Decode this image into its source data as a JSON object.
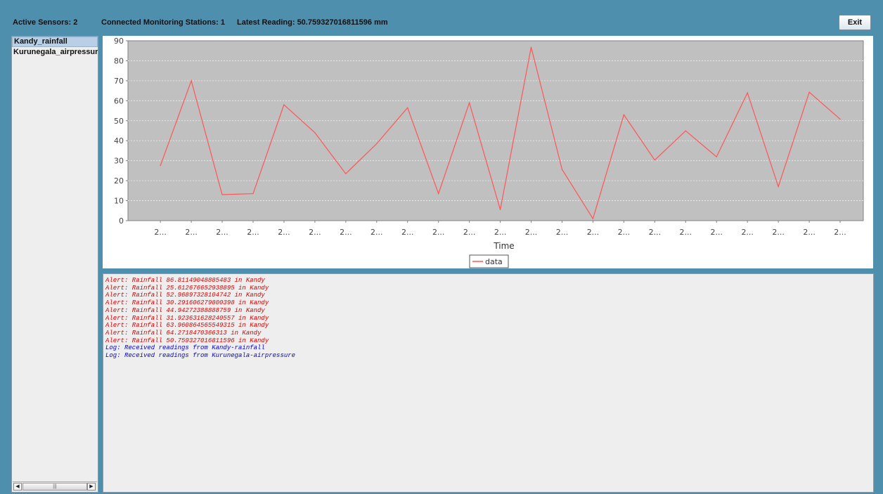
{
  "header": {
    "active_sensors": "Active Sensors:  2",
    "stations": "Connected Monitoring Stations:  1",
    "latest": "Latest Reading:  50.759327016811596 mm",
    "exit_label": "Exit"
  },
  "sidebar": {
    "items": [
      {
        "label": "Kandy_rainfall",
        "selected": true
      },
      {
        "label": "Kurunegala_airpressure",
        "selected": false
      }
    ],
    "scroll_left_glyph": "◀",
    "scroll_right_glyph": "▶",
    "scroll_thumb_glyph": "|||"
  },
  "chart_data": {
    "type": "line",
    "xlabel": "Time",
    "ylabel": "",
    "ylim": [
      0,
      90
    ],
    "yticks": [
      0,
      10,
      20,
      30,
      40,
      50,
      60,
      70,
      80,
      90
    ],
    "grid": true,
    "legend": "bottom-center",
    "categories": [
      "2...",
      "2...",
      "2...",
      "2...",
      "2...",
      "2...",
      "2...",
      "2...",
      "2...",
      "2...",
      "2...",
      "2...",
      "2...",
      "2...",
      "2...",
      "2...",
      "2...",
      "2...",
      "2...",
      "2...",
      "2...",
      "2...",
      "2..."
    ],
    "series": [
      {
        "name": "data",
        "color": "#ff5555",
        "values": [
          27.5,
          70.0,
          13.0,
          13.5,
          58.0,
          44.0,
          23.5,
          38.5,
          56.5,
          13.5,
          59.0,
          5.5,
          86.81149048885483,
          25.612676652938895,
          1.0,
          52.96897328104742,
          30.291606279800398,
          44.94272388888759,
          31.923631628240557,
          63.960864565549315,
          17.0,
          64.2718470366313,
          50.759327016811596
        ]
      }
    ],
    "plot_bg": "#c0c0c0"
  },
  "log": {
    "lines": [
      {
        "text": "Alert: Rainfall 86.81149048885483 in Kandy",
        "kind": "alert"
      },
      {
        "text": "Alert: Rainfall 25.612676652938895 in Kandy",
        "kind": "alert"
      },
      {
        "text": "Alert: Rainfall 52.96897328104742 in Kandy",
        "kind": "alert"
      },
      {
        "text": "Alert: Rainfall 30.291606279800398 in Kandy",
        "kind": "alert"
      },
      {
        "text": "Alert: Rainfall 44.94272388888759 in Kandy",
        "kind": "alert"
      },
      {
        "text": "Alert: Rainfall 31.923631628240557 in Kandy",
        "kind": "alert"
      },
      {
        "text": "Alert: Rainfall 63.960864565549315 in Kandy",
        "kind": "alert"
      },
      {
        "text": "Alert: Rainfall 64.2718470366313 in Kandy",
        "kind": "alert"
      },
      {
        "text": "Alert: Rainfall 50.759327016811596 in Kandy",
        "kind": "alert"
      },
      {
        "text": "Log: Received readings from Kandy-rainfall",
        "kind": "info"
      },
      {
        "text": "Log: Received readings from Kurunegala-airpressure",
        "kind": "info"
      }
    ]
  },
  "colors": {
    "frame": "#4f8fae",
    "alert": "#e00000",
    "log": "#0000e0"
  }
}
